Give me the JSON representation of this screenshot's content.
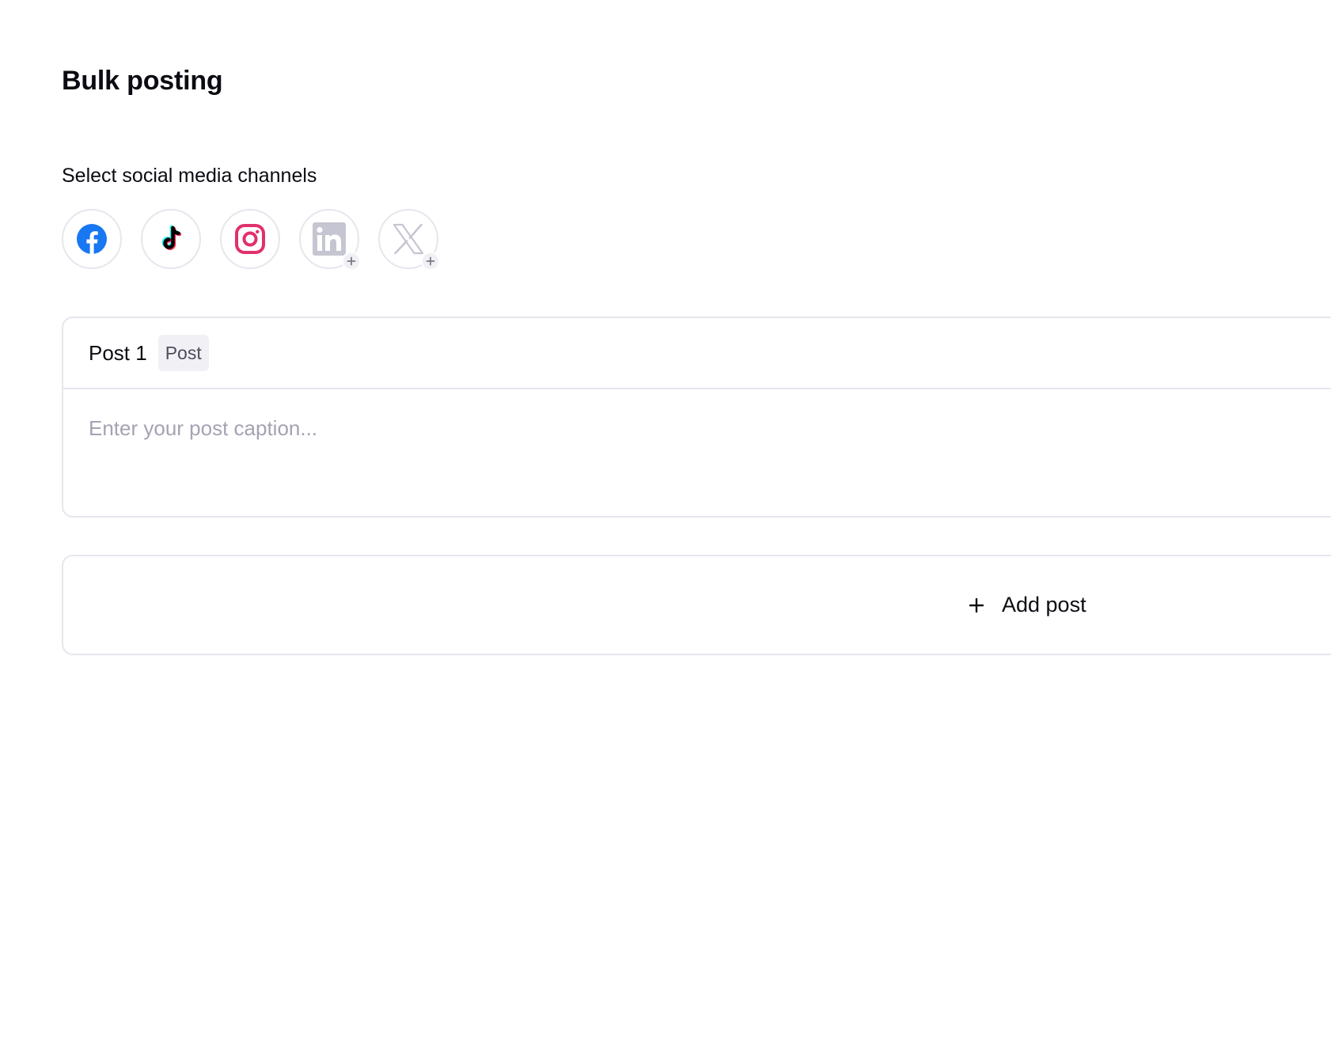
{
  "page": {
    "title": "Bulk posting"
  },
  "channels": {
    "label": "Select social media channels",
    "items": [
      {
        "name": "Facebook",
        "icon": "facebook-icon",
        "connected": true,
        "color": "#1877F2"
      },
      {
        "name": "TikTok",
        "icon": "tiktok-icon",
        "connected": true,
        "color": "#000000"
      },
      {
        "name": "Instagram",
        "icon": "instagram-icon",
        "connected": true,
        "color": "#E1306C"
      },
      {
        "name": "LinkedIn",
        "icon": "linkedin-icon",
        "connected": false,
        "color": "#C6C6D2"
      },
      {
        "name": "X",
        "icon": "x-icon",
        "connected": false,
        "color": "#C6C6D2"
      }
    ]
  },
  "posts": [
    {
      "title": "Post 1",
      "type_chip": "Post",
      "caption_placeholder": "Enter your post caption...",
      "caption_value": ""
    }
  ],
  "add_post": {
    "label": "Add post",
    "icon": "plus-icon"
  },
  "colors": {
    "border": "#E6E6EE",
    "placeholder": "#A3A3B3",
    "chip_bg": "#F1F1F5",
    "text": "#0B0B12"
  }
}
